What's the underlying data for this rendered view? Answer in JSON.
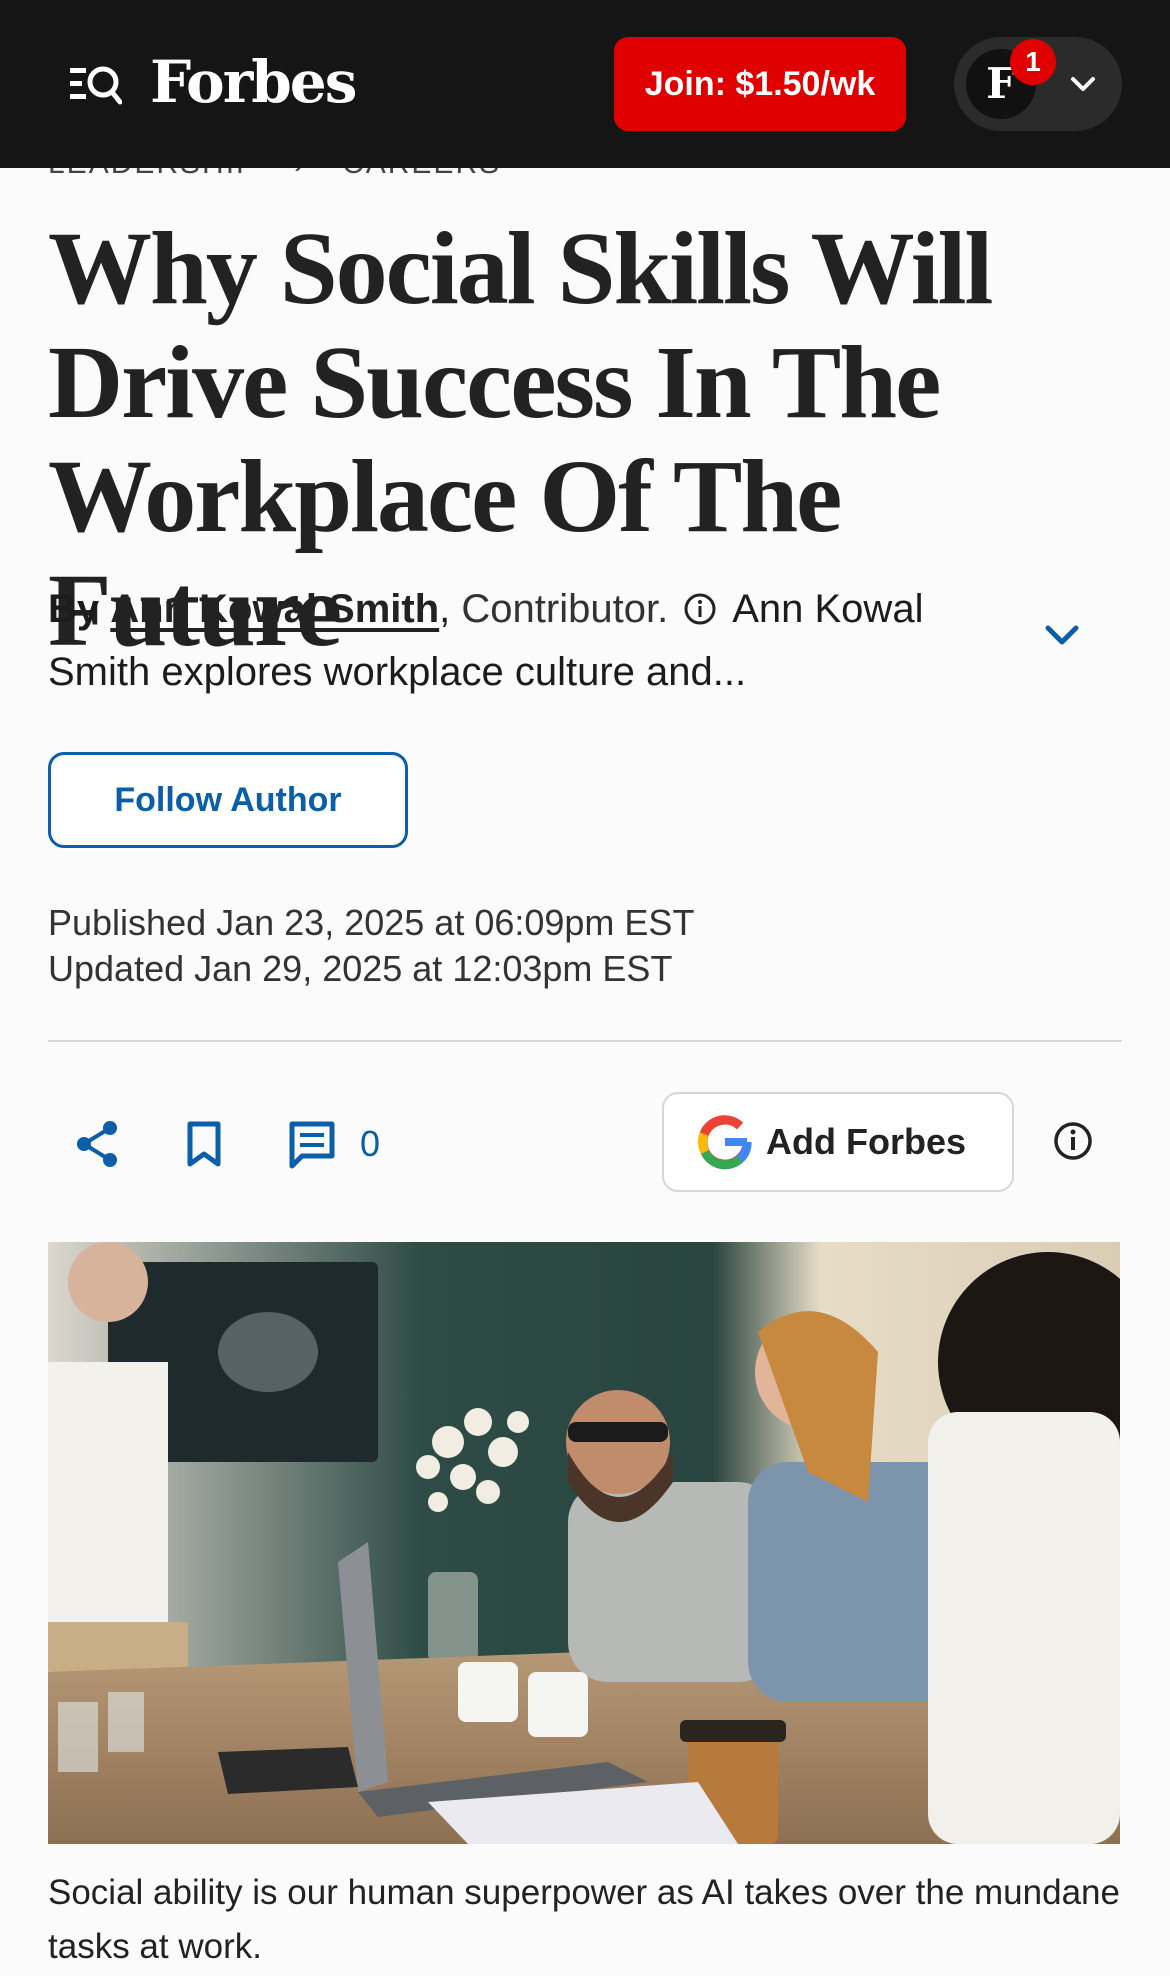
{
  "header": {
    "logo": "Forbes",
    "join_label": "Join: $1.50/wk",
    "avatar_letter": "F",
    "notification_count": "1"
  },
  "breadcrumb": {
    "items": [
      "LEADERSHIP",
      "CAREERS"
    ]
  },
  "article": {
    "title": "Why Social Skills Will Drive Success In The Workplace Of The Future",
    "by_label": "By",
    "author": "Ann Kowal Smith",
    "role": "Contributor.",
    "bio": "Ann Kowal Smith explores workplace culture and...",
    "follow_label": "Follow Author",
    "published": "Published Jan 23, 2025 at 06:09pm EST",
    "updated": "Updated Jan 29, 2025 at 12:03pm EST",
    "comment_count": "0",
    "add_forbes_label": "Add Forbes",
    "caption": "Social ability is our human superpower as AI takes over the mundane tasks at work."
  },
  "icons": {
    "menu_search": "menu-search-icon",
    "share": "share-icon",
    "bookmark": "bookmark-icon",
    "comment": "comment-icon",
    "google": "google-icon",
    "info": "info-icon",
    "chevron": "chevron-down-icon"
  },
  "colors": {
    "header_bg": "#151515",
    "join_red": "#e10000",
    "accent_blue": "#0a5fa8"
  }
}
